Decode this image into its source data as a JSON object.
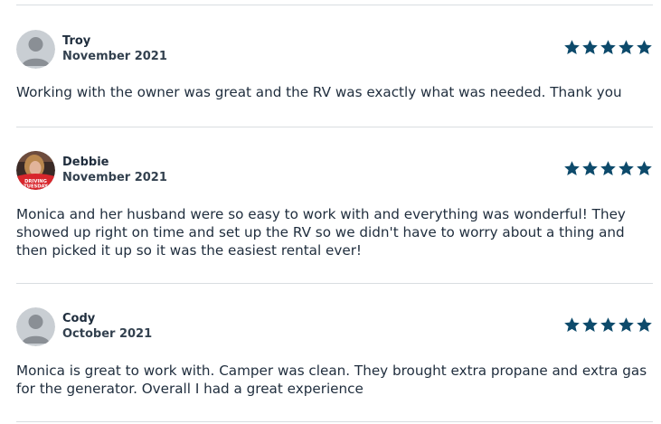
{
  "colors": {
    "star": "#0d4a6b",
    "divider": "#d9dde1",
    "avatar_bg": "#c9ced3",
    "avatar_silhouette": "#8a8f95"
  },
  "reviews": [
    {
      "name": "Troy",
      "date": "November 2021",
      "rating": 5,
      "avatar": "default-avatar-icon",
      "text": "Working with the owner was great and the RV was exactly what was needed. Thank you"
    },
    {
      "name": "Debbie",
      "date": "November 2021",
      "rating": 5,
      "avatar": "user-photo",
      "avatar_caption": "DRIVING TUESDAY",
      "text": "Monica and her husband were so easy to work with and everything was wonderful! They showed up right on time and set up the RV so we didn't have to worry about a thing and then picked it up so it was the easiest rental ever!"
    },
    {
      "name": "Cody",
      "date": "October 2021",
      "rating": 5,
      "avatar": "default-avatar-icon",
      "text": "Monica is great to work with. Camper was clean. They brought extra propane and extra gas for the generator. Overall I had a great experience"
    }
  ]
}
